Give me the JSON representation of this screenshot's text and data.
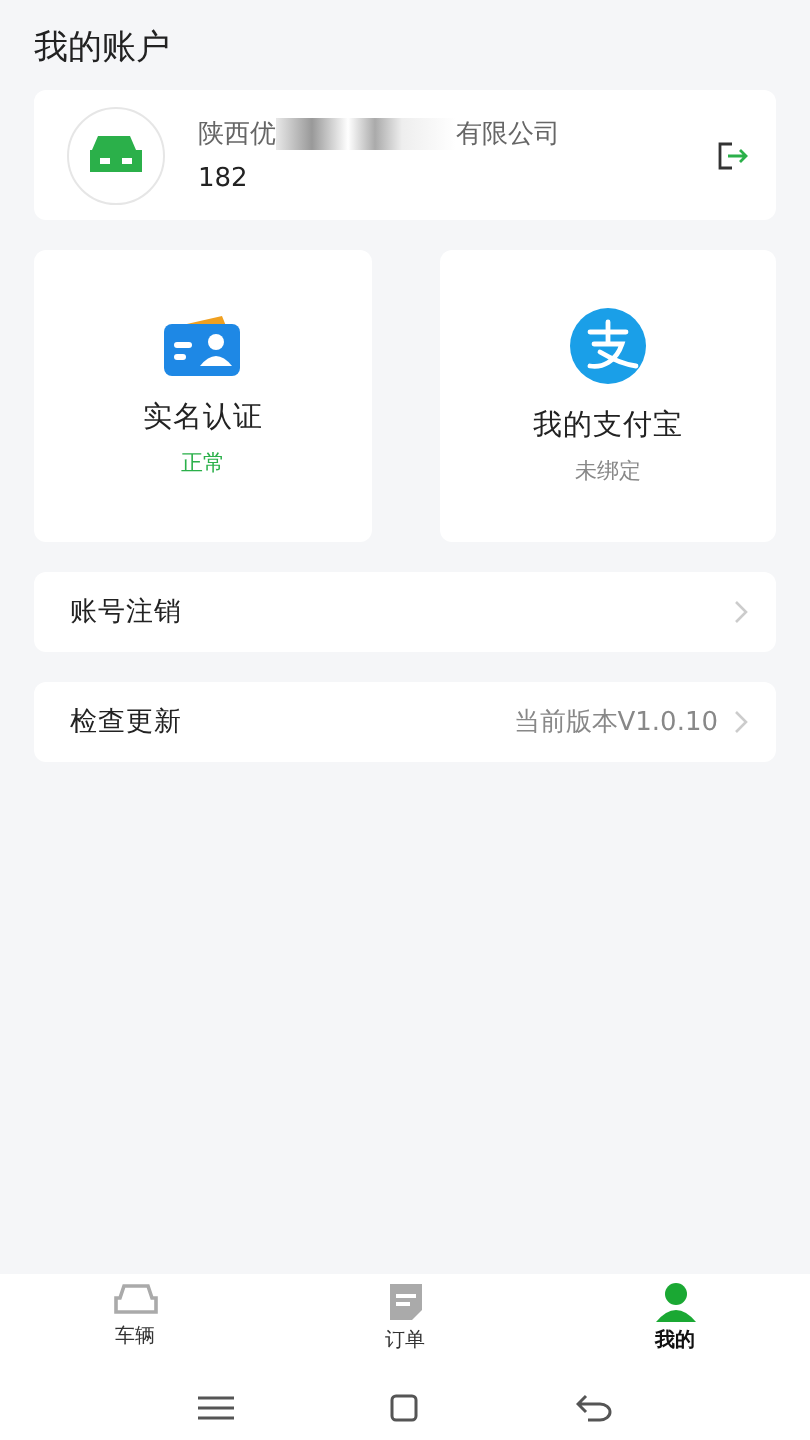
{
  "page_title": "我的账户",
  "account": {
    "name_start": "陕西优",
    "name_end": "有限公司",
    "phone": "182"
  },
  "tiles": [
    {
      "kind": "idcard",
      "title": "实名认证",
      "status": "正常",
      "ok": true
    },
    {
      "kind": "alipay",
      "title": "我的支付宝",
      "status": "未绑定",
      "ok": false
    }
  ],
  "rows": [
    {
      "label": "账号注销"
    },
    {
      "label": "检查更新",
      "value": "当前版本V1.0.10"
    }
  ],
  "tabs": [
    {
      "kind": "car",
      "label": "车辆",
      "selected": false
    },
    {
      "kind": "order",
      "label": "订单",
      "selected": false
    },
    {
      "kind": "user",
      "label": "我的",
      "selected": true
    }
  ]
}
